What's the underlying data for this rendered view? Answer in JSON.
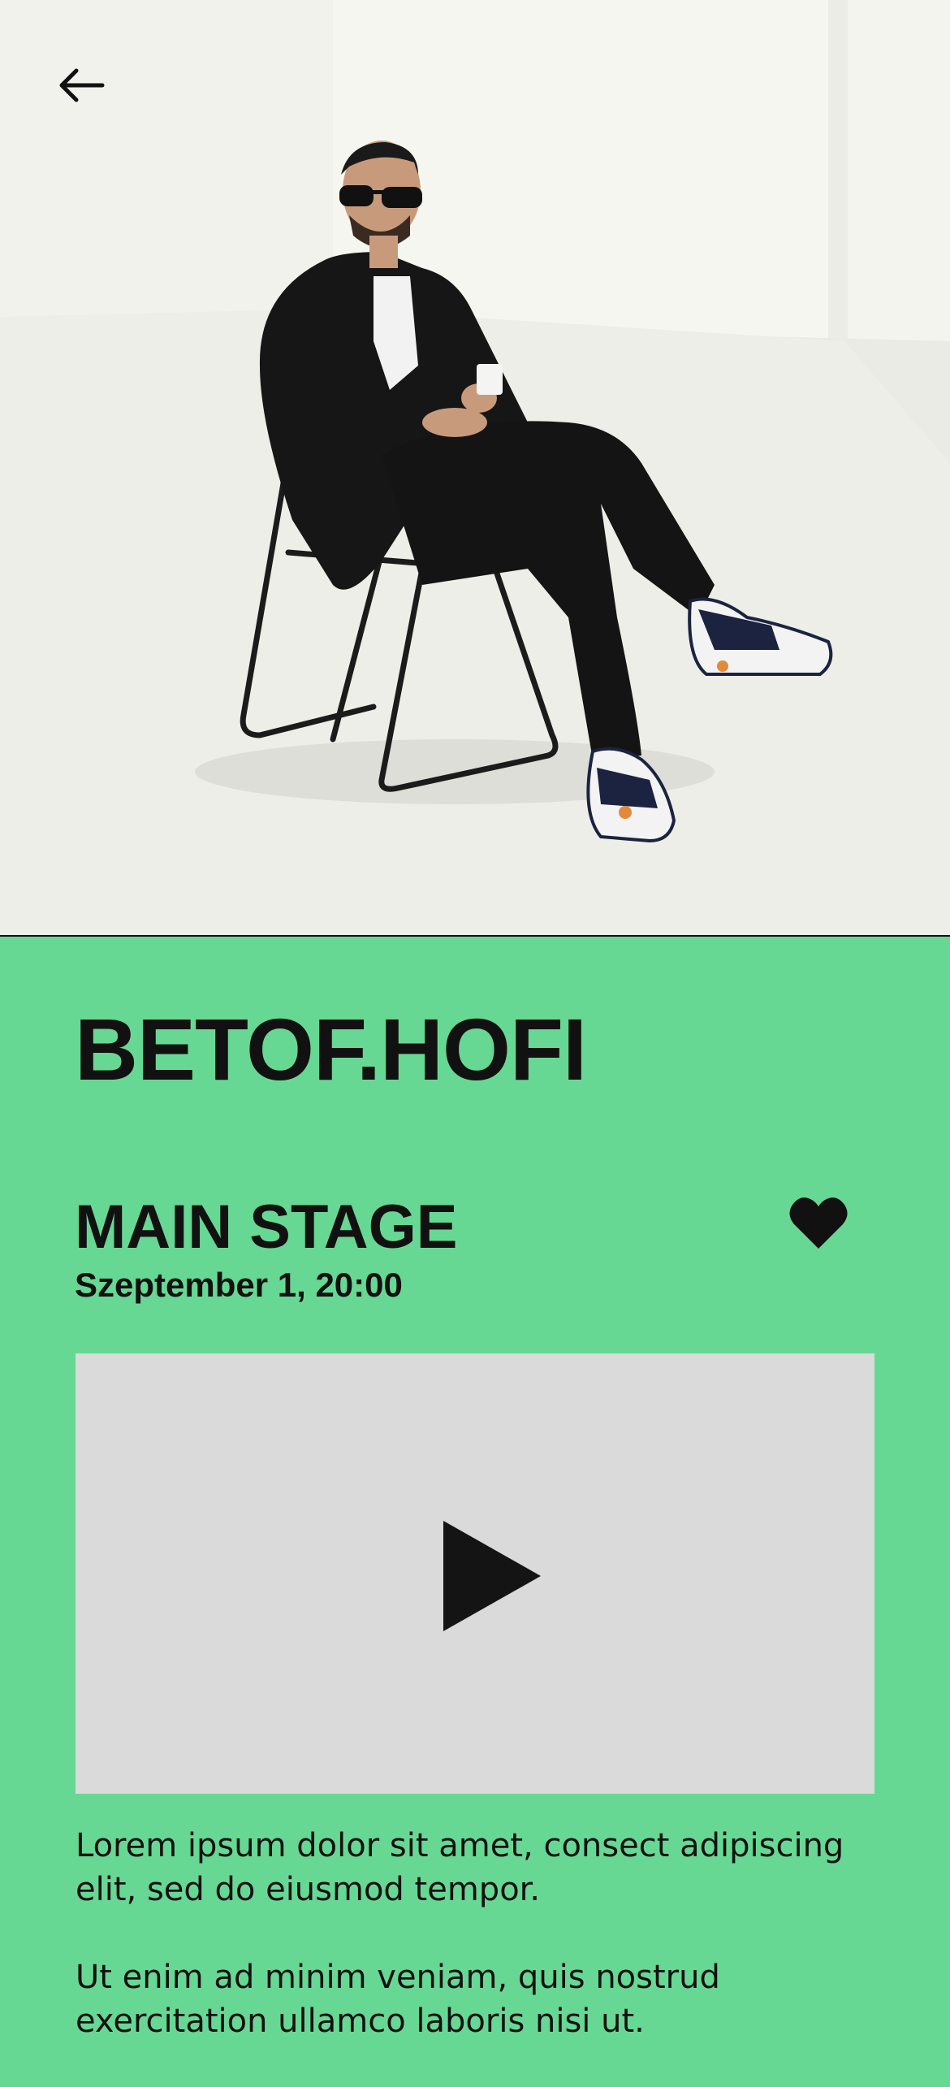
{
  "header": {
    "back_icon": "arrow-left-icon"
  },
  "hero": {
    "image": "artist photo: man in black suit and sunglasses seated on chair, white studio"
  },
  "artist": {
    "name": "BETOF.HOFI"
  },
  "event": {
    "stage": "MAIN STAGE",
    "datetime": "Szeptember 1, 20:00",
    "favorite_icon": "heart-icon"
  },
  "video": {
    "play_icon": "play-icon"
  },
  "description": {
    "paragraph_1": "Lorem ipsum dolor sit amet, consect adipiscing elit, sed do eiusmod tempor.",
    "paragraph_2": "Ut enim ad minim veniam, quis nostrud exercitation ullamco laboris nisi ut."
  },
  "colors": {
    "accent_green": "#67d894",
    "text": "#111111",
    "video_placeholder": "#dadada"
  }
}
